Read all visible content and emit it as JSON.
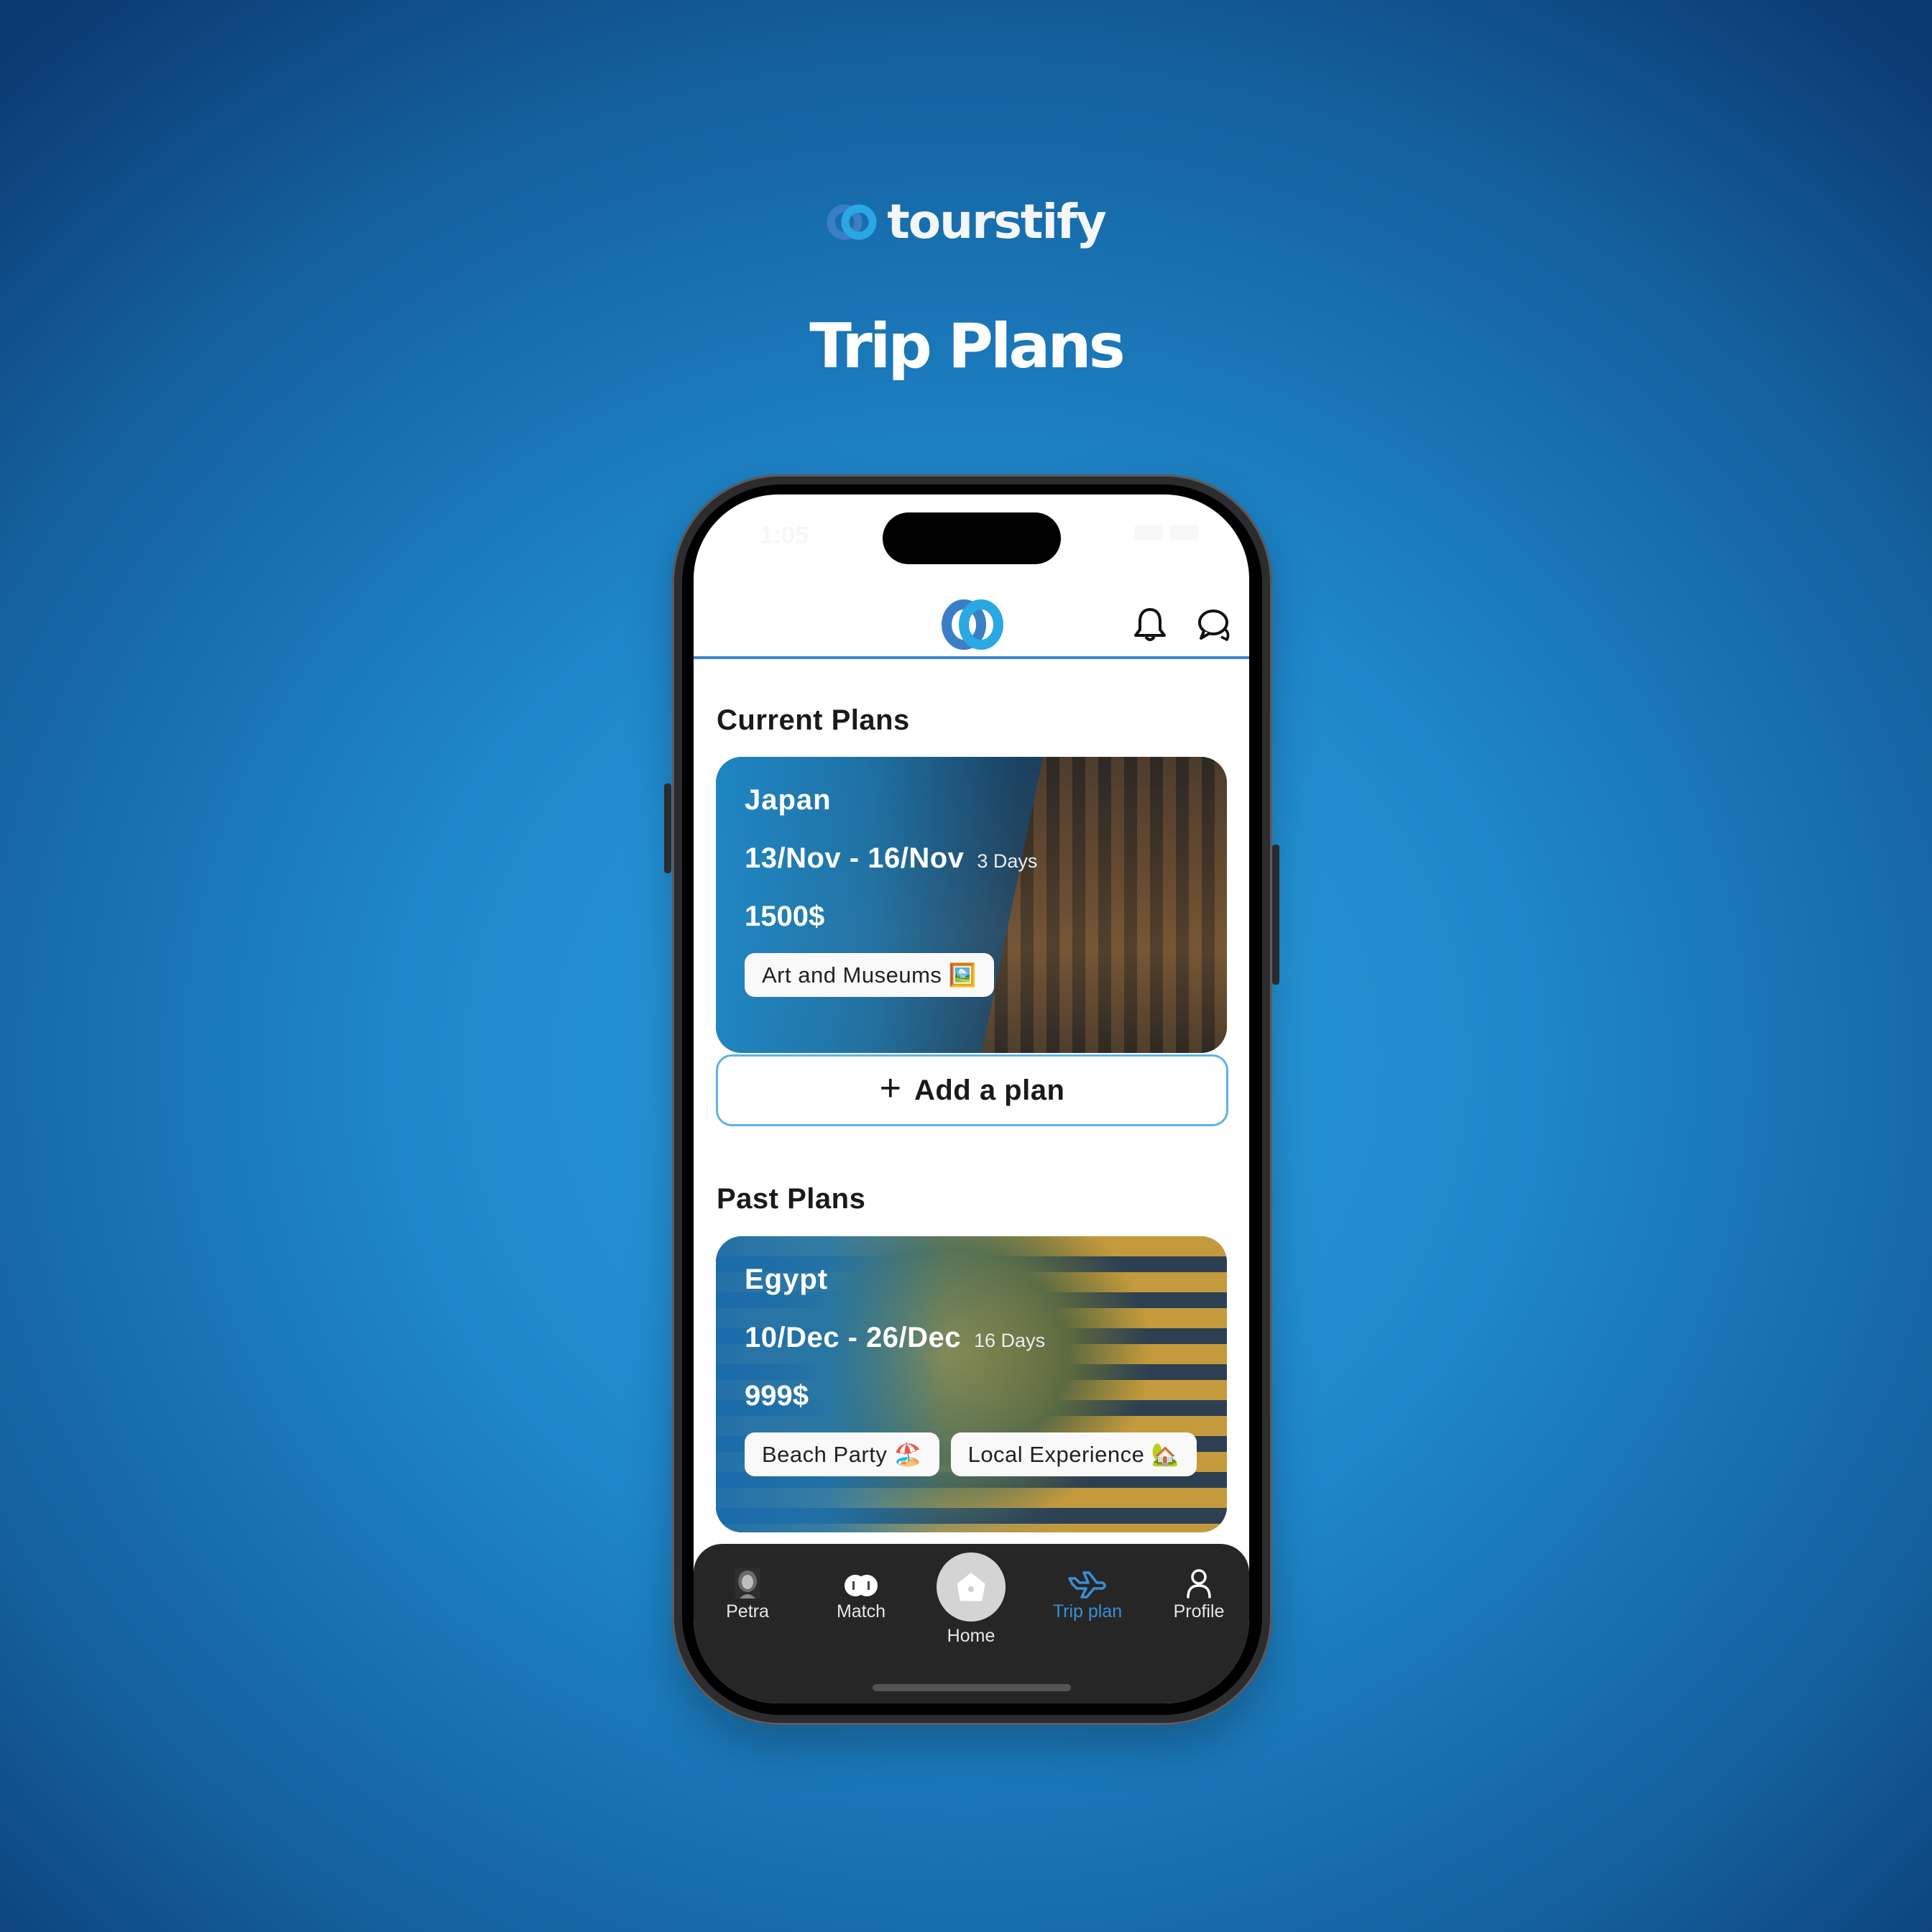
{
  "brand": {
    "name": "tourstify",
    "logo_icon": "interlocked-rings-logo-icon"
  },
  "page_heading": "Trip Plans",
  "status_bar": {
    "time": "1:05"
  },
  "app_header": {
    "logo_icon": "interlocked-rings-logo-icon",
    "notifications_icon": "bell-icon",
    "messages_icon": "chat-bubbles-icon"
  },
  "sections": {
    "current": {
      "title": "Current Plans",
      "plans": [
        {
          "destination": "Japan",
          "dates": "13/Nov - 16/Nov",
          "duration": "3 Days",
          "price": "1500$",
          "tags": [
            "Art and Museums 🖼️"
          ]
        }
      ],
      "add_button": {
        "icon": "plus-icon",
        "label": "Add a plan"
      }
    },
    "past": {
      "title": "Past Plans",
      "plans": [
        {
          "destination": "Egypt",
          "dates": "10/Dec - 26/Dec",
          "duration": "16 Days",
          "price": "999$",
          "tags": [
            "Beach Party 🏖️",
            "Local Experience 🏡"
          ]
        }
      ]
    }
  },
  "bottom_nav": {
    "items": [
      {
        "label": "Petra",
        "icon": "petra-avatar-icon",
        "active": false
      },
      {
        "label": "Match",
        "icon": "match-rings-icon",
        "active": false
      },
      {
        "label": "Home",
        "icon": "home-icon",
        "active": false
      },
      {
        "label": "Trip plan",
        "icon": "airplane-icon",
        "active": true
      },
      {
        "label": "Profile",
        "icon": "person-icon",
        "active": false
      }
    ],
    "active_color": "#3a8fd6"
  },
  "colors": {
    "accent": "#3b86d0",
    "add_button_border": "#5ab4ea",
    "nav_background": "#262626"
  }
}
